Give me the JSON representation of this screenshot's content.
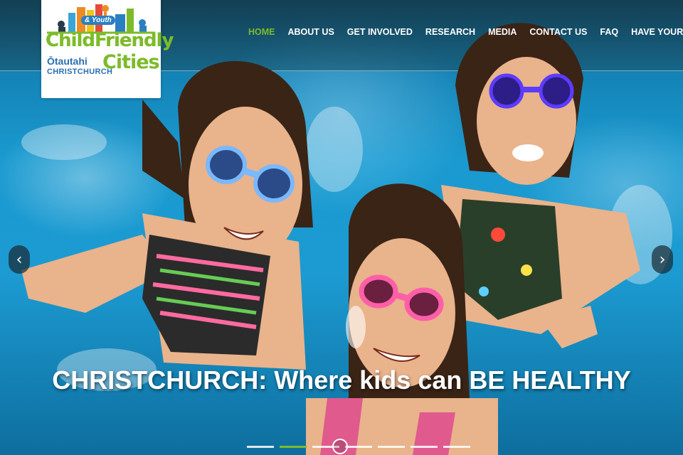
{
  "logo": {
    "tagline": "& Youth",
    "brand_line1_a": "Child",
    "brand_line1_b": "Friendly",
    "brand_line2": "Cities",
    "place_maori": "Ōtautahi",
    "place_english": "CHRISTCHURCH"
  },
  "nav": {
    "items": [
      {
        "label": "HOME",
        "active": true
      },
      {
        "label": "ABOUT US",
        "active": false
      },
      {
        "label": "GET INVOLVED",
        "active": false
      },
      {
        "label": "RESEARCH",
        "active": false
      },
      {
        "label": "MEDIA",
        "active": false
      },
      {
        "label": "CONTACT US",
        "active": false
      },
      {
        "label": "FAQ",
        "active": false
      },
      {
        "label": "HAVE YOUR SAY",
        "active": false
      }
    ]
  },
  "slider": {
    "caption": "CHRISTCHURCH: Where kids can BE HEALTHY",
    "prev_icon": "chevron-left-icon",
    "next_icon": "chevron-right-icon",
    "prev_glyph": "‹",
    "next_glyph": "›",
    "slide_count": 7,
    "active_slide": 2
  },
  "colors": {
    "accent": "#7dbb2b",
    "nav_text": "#ffffff",
    "logo_blue": "#2a6fb0"
  }
}
